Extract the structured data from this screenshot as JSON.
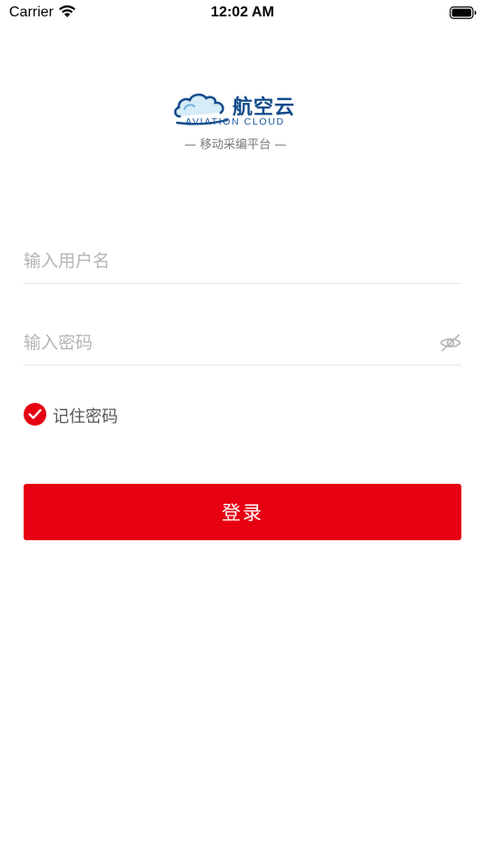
{
  "status_bar": {
    "carrier": "Carrier",
    "time": "12:02 AM"
  },
  "logo": {
    "brand_cn": "航空云",
    "brand_en": "AVIATION CLOUD",
    "tagline": "— 移动采编平台 —"
  },
  "form": {
    "username_placeholder": "输入用户名",
    "password_placeholder": "输入密码",
    "remember_label": "记住密码",
    "remember_checked": true,
    "login_label": "登录"
  },
  "colors": {
    "accent": "#e60012",
    "brand_blue": "#134b8a"
  }
}
